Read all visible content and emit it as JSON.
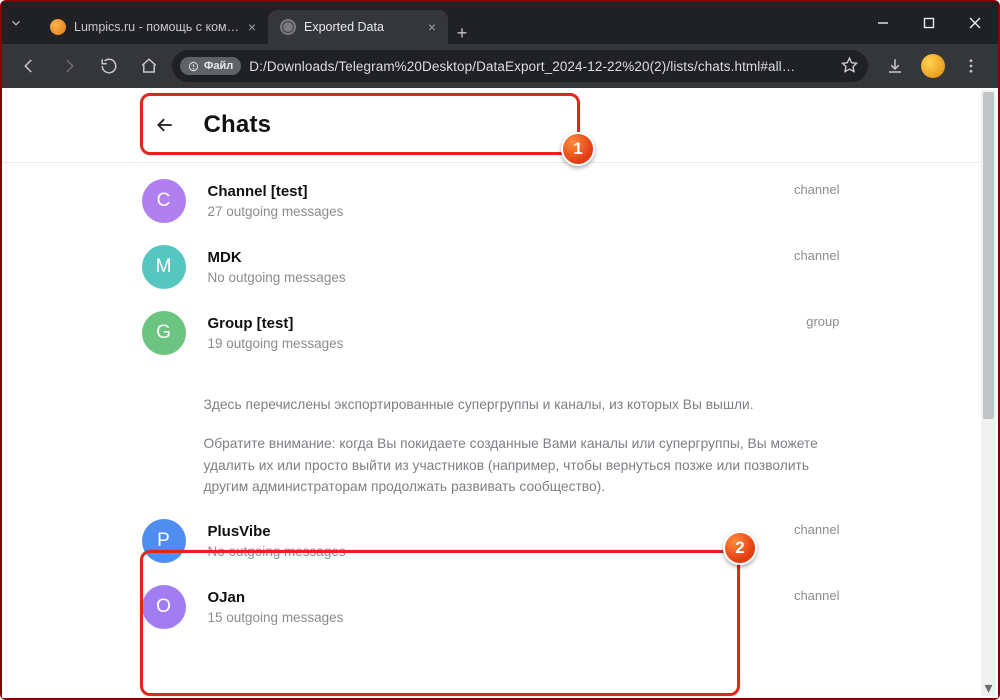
{
  "window": {
    "tabs": [
      {
        "title": "Lumpics.ru - помощь с компью",
        "active": false
      },
      {
        "title": "Exported Data",
        "active": true
      }
    ]
  },
  "toolbar": {
    "file_badge": "Файл",
    "url": "D:/Downloads/Telegram%20Desktop/DataExport_2024-12-22%20(2)/lists/chats.html#all…"
  },
  "page": {
    "title": "Chats",
    "chats": [
      {
        "letter": "C",
        "name": "Channel [test]",
        "sub": "27 outgoing messages",
        "type": "channel",
        "av": "av-c"
      },
      {
        "letter": "M",
        "name": "MDK",
        "sub": "No outgoing messages",
        "type": "channel",
        "av": "av-m"
      },
      {
        "letter": "G",
        "name": "Group [test]",
        "sub": "19 outgoing messages",
        "type": "group",
        "av": "av-g"
      }
    ],
    "note_p1": "Здесь перечислены экспортированные супергруппы и каналы, из которых Вы вышли.",
    "note_p2": "Обратите внимание: когда Вы покидаете созданные Вами каналы или супергруппы, Вы можете удалить их или просто выйти из участников (например, чтобы вернуться позже или позволить другим администраторам продолжать развивать сообщество).",
    "left_chats": [
      {
        "letter": "P",
        "name": "PlusVibe",
        "sub": "No outgoing messages",
        "type": "channel",
        "av": "av-p"
      },
      {
        "letter": "O",
        "name": "OJan",
        "sub": "15 outgoing messages",
        "type": "channel",
        "av": "av-o"
      }
    ]
  },
  "annotations": {
    "b1": "1",
    "b2": "2"
  }
}
